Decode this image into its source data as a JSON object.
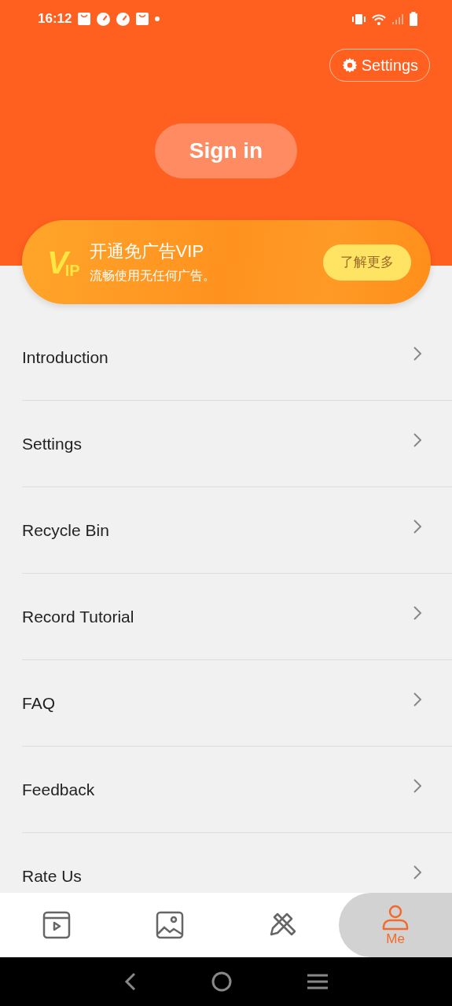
{
  "status_bar": {
    "time": "16:12"
  },
  "header": {
    "settings_button": "Settings",
    "sign_in_button": "Sign in"
  },
  "vip_card": {
    "logo_letter": "V",
    "logo_suffix": "IP",
    "title": "开通免广告VIP",
    "subtitle": "流畅使用无任何广告。",
    "button": "了解更多"
  },
  "menu_items": [
    {
      "label": "Introduction"
    },
    {
      "label": "Settings"
    },
    {
      "label": "Recycle Bin"
    },
    {
      "label": "Record Tutorial"
    },
    {
      "label": "FAQ"
    },
    {
      "label": "Feedback"
    },
    {
      "label": "Rate Us"
    }
  ],
  "bottom_tabs": [
    {
      "kind": "video",
      "selected": false
    },
    {
      "kind": "image",
      "selected": false
    },
    {
      "kind": "tools",
      "selected": false
    },
    {
      "kind": "person",
      "label": "Me",
      "selected": true
    }
  ]
}
